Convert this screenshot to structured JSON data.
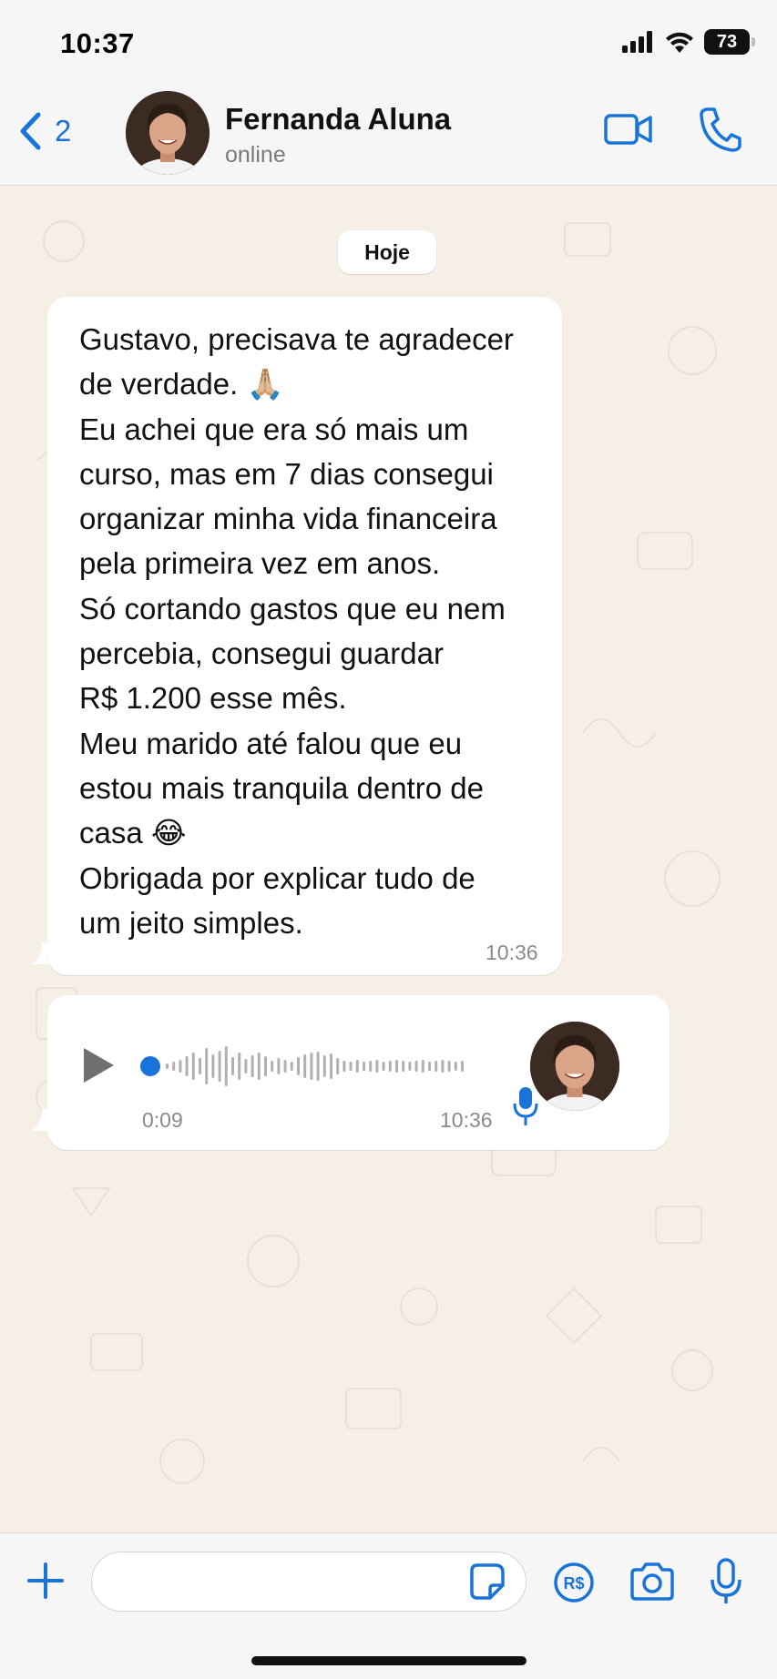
{
  "status_bar": {
    "time": "10:37",
    "battery": "73"
  },
  "header": {
    "back_count": "2",
    "contact_name": "Fernanda Aluna",
    "contact_status": "online"
  },
  "chat": {
    "date_chip": "Hoje",
    "messages": [
      {
        "lines": [
          "Gustavo, precisava te agradecer",
          "de verdade. 🙏🏼",
          "Eu achei que era só mais um",
          "curso, mas em 7 dias consegui",
          "organizar minha vida financeira",
          "pela primeira vez em anos.",
          "Só cortando gastos que eu nem",
          "percebia, consegui guardar",
          "R$ 1.200 esse mês.",
          "Meu marido até falou que eu",
          "estou mais tranquila dentro de",
          "casa 😂",
          "Obrigada por explicar tudo de",
          "um jeito simples."
        ],
        "time": "10:36"
      }
    ],
    "audio": {
      "duration": "0:09",
      "time": "10:36",
      "progress": 0
    }
  },
  "input_bar": {
    "placeholder": "",
    "pay_label": "R$"
  },
  "colors": {
    "accent": "#1a73d9",
    "chat_bg": "#f6efe6",
    "bubble": "#ffffff",
    "bar_bg": "#f6f6f6"
  },
  "icons": [
    "chevron-left-icon",
    "video-icon",
    "phone-icon",
    "play-icon",
    "mic-icon",
    "plus-icon",
    "sticker-icon",
    "payment-icon",
    "camera-icon"
  ]
}
